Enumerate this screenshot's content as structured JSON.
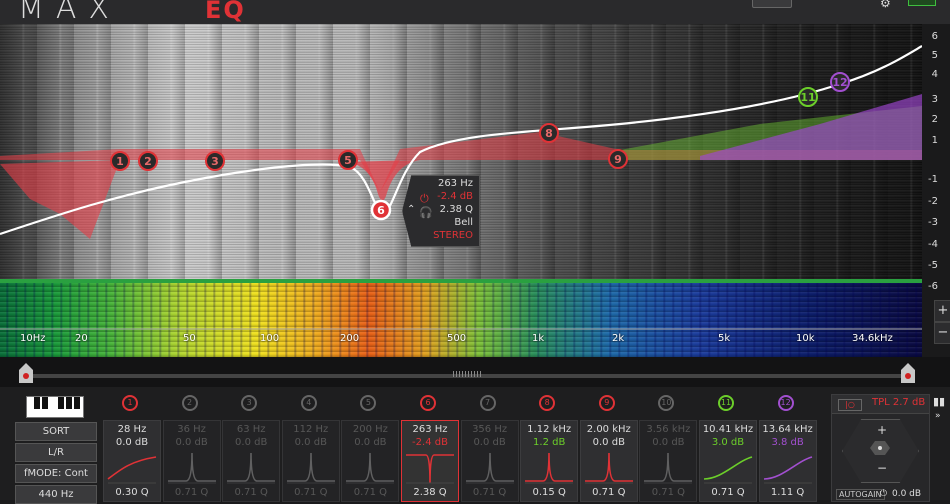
{
  "app": {
    "brand": "MAX",
    "brand_sub": "EQ"
  },
  "db_scale": [
    "6",
    "5",
    "4",
    "3",
    "2",
    "1",
    "-1",
    "-2",
    "-3",
    "-4",
    "-5",
    "-6"
  ],
  "freq_axis": [
    "10Hz",
    "20",
    "50",
    "100",
    "200",
    "500",
    "1k",
    "2k",
    "5k",
    "10k",
    "34.6kHz"
  ],
  "graph_nodes": [
    "1",
    "2",
    "3",
    "5",
    "6",
    "8",
    "9",
    "11",
    "12"
  ],
  "tooltip": {
    "freq": "263 Hz",
    "gain": "-2.4 dB",
    "q": "2.38 Q",
    "type": "Bell",
    "mode": "STEREO"
  },
  "left_buttons": {
    "sort": "SORT",
    "lr": "L/R",
    "fmode": "fMODE: Cont",
    "ref": "440 Hz"
  },
  "bands": [
    {
      "num": "1",
      "freq": "28 Hz",
      "gain": "0.0 dB",
      "q": "0.30 Q",
      "shape": "lowshelf",
      "state": "active",
      "color": "#e03236"
    },
    {
      "num": "2",
      "freq": "36 Hz",
      "gain": "0.0 dB",
      "q": "0.71 Q",
      "shape": "bell",
      "state": "inactive",
      "color": "#666666"
    },
    {
      "num": "3",
      "freq": "63 Hz",
      "gain": "0.0 dB",
      "q": "0.71 Q",
      "shape": "bell",
      "state": "inactive",
      "color": "#666666"
    },
    {
      "num": "4",
      "freq": "112 Hz",
      "gain": "0.0 dB",
      "q": "0.71 Q",
      "shape": "bell",
      "state": "inactive",
      "color": "#666666"
    },
    {
      "num": "5",
      "freq": "200 Hz",
      "gain": "0.0 dB",
      "q": "0.71 Q",
      "shape": "bell",
      "state": "inactive",
      "color": "#666666"
    },
    {
      "num": "6",
      "freq": "263 Hz",
      "gain": "-2.4 dB",
      "q": "2.38 Q",
      "shape": "notch",
      "state": "selected",
      "color": "#e03236"
    },
    {
      "num": "7",
      "freq": "356 Hz",
      "gain": "0.0 dB",
      "q": "0.71 Q",
      "shape": "bell",
      "state": "inactive",
      "color": "#666666"
    },
    {
      "num": "8",
      "freq": "1.12 kHz",
      "gain": "1.2 dB",
      "q": "0.15 Q",
      "shape": "bell",
      "state": "active",
      "color": "#e03236"
    },
    {
      "num": "9",
      "freq": "2.00 kHz",
      "gain": "0.0 dB",
      "q": "0.71 Q",
      "shape": "bell",
      "state": "active",
      "color": "#e03236"
    },
    {
      "num": "10",
      "freq": "3.56 kHz",
      "gain": "0.0 dB",
      "q": "0.71 Q",
      "shape": "bell",
      "state": "inactive",
      "color": "#666666"
    },
    {
      "num": "11",
      "freq": "10.41 kHz",
      "gain": "3.0 dB",
      "q": "0.71 Q",
      "shape": "highshelf",
      "state": "active",
      "color": "#6ccf2a"
    },
    {
      "num": "12",
      "freq": "13.64 kHz",
      "gain": "3.8 dB",
      "q": "1.11 Q",
      "shape": "highshelf",
      "state": "active",
      "color": "#a24fd0"
    }
  ],
  "right_panel": {
    "tpl": "TPL 2.7 dB",
    "autogain": "AUTOGAIN",
    "gain_value": "0.0 dB",
    "plus": "+",
    "minus": "−"
  },
  "zoom": {
    "plus": "+",
    "minus": "−"
  }
}
